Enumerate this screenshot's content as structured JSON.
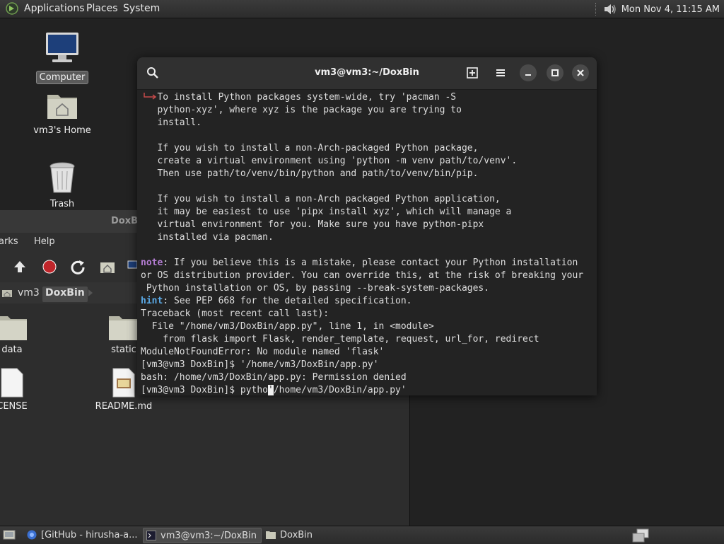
{
  "top_panel": {
    "menus": [
      "Applications",
      "Places",
      "System"
    ],
    "clock": "Mon Nov  4, 11:15 AM"
  },
  "desktop": {
    "icons": [
      {
        "label": "Computer",
        "icon": "computer-icon"
      },
      {
        "label": "vm3's Home",
        "icon": "home-folder-icon"
      },
      {
        "label": "Trash",
        "icon": "trash-icon"
      }
    ]
  },
  "file_manager": {
    "title": "DoxBi",
    "menu_items": [
      "arks",
      "Help"
    ],
    "breadcrumbs": [
      "vm3",
      "DoxBin"
    ],
    "files": [
      {
        "name": "data",
        "icon": "folder-icon"
      },
      {
        "name": "static",
        "icon": "folder-icon"
      },
      {
        "name": "CENSE",
        "icon": "text-file-icon"
      },
      {
        "name": "README.md",
        "icon": "markdown-file-icon"
      }
    ]
  },
  "terminal": {
    "title": "vm3@vm3:~/DoxBin",
    "lines": [
      "   To install Python packages system-wide, try 'pacman -S",
      "   python-xyz', where xyz is the package you are trying to",
      "   install.",
      "",
      "   If you wish to install a non-Arch-packaged Python package,",
      "   create a virtual environment using 'python -m venv path/to/venv'.",
      "   Then use path/to/venv/bin/python and path/to/venv/bin/pip.",
      "",
      "   If you wish to install a non-Arch packaged Python application,",
      "   it may be easiest to use 'pipx install xyz', which will manage a",
      "   virtual environment for you. Make sure you have python-pipx",
      "   installed via pacman.",
      ""
    ],
    "note_label": "note",
    "note_lines": [
      ": If you believe this is a mistake, please contact your Python installation",
      "or OS distribution provider. You can override this, at the risk of breaking your",
      " Python installation or OS, by passing --break-system-packages."
    ],
    "hint_label": "hint",
    "hint_text": ": See PEP 668 for the detailed specification.",
    "output_lines": [
      "Traceback (most recent call last):",
      "  File \"/home/vm3/DoxBin/app.py\", line 1, in <module>",
      "    from flask import Flask, render_template, request, url_for, redirect",
      "ModuleNotFoundError: No module named 'flask'",
      "[vm3@vm3 DoxBin]$ '/home/vm3/DoxBin/app.py'",
      "bash: /home/vm3/DoxBin/app.py: Permission denied"
    ],
    "prompt_before_cursor": "[vm3@vm3 DoxBin]$ pytho",
    "cursor_char": "'",
    "prompt_after_cursor": "/home/vm3/DoxBin/app.py'"
  },
  "taskbar": {
    "tasks": [
      {
        "label": "[GitHub - hirusha-a...",
        "icon": "browser-icon"
      },
      {
        "label": "vm3@vm3:~/DoxBin",
        "icon": "terminal-icon",
        "active": true
      },
      {
        "label": "DoxBin",
        "icon": "folder-icon"
      }
    ]
  }
}
